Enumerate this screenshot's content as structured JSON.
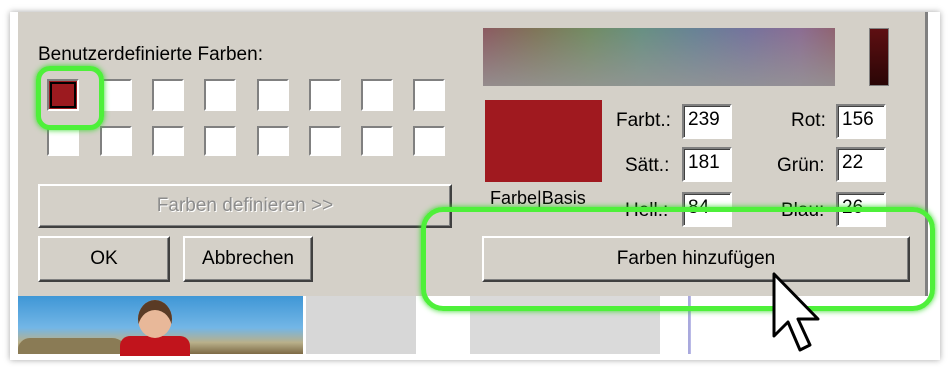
{
  "dialog": {
    "custom_colors_label": "Benutzerdefinierte Farben:",
    "define_colors_button": "Farben definieren >>",
    "ok_button": "OK",
    "cancel_button": "Abbrechen",
    "custom_colors": [
      "#9c1a1f",
      "#ffffff",
      "#ffffff",
      "#ffffff",
      "#ffffff",
      "#ffffff",
      "#ffffff",
      "#ffffff",
      "#ffffff",
      "#ffffff",
      "#ffffff",
      "#ffffff",
      "#ffffff",
      "#ffffff",
      "#ffffff",
      "#ffffff"
    ],
    "color_solid_label": "Farbe|Basis",
    "add_colors_button": "Farben hinzufügen",
    "fields": {
      "hue_label": "Farbt.:",
      "hue_value": "239",
      "sat_label": "Sätt.:",
      "sat_value": "181",
      "lum_label": "Hell.:",
      "lum_value": "84",
      "red_label": "Rot:",
      "red_value": "156",
      "green_label": "Grün:",
      "green_value": "22",
      "blue_label": "Blau:",
      "blue_value": "26"
    }
  },
  "colors": {
    "dialog_bg": "#d4d0c8",
    "selected_color": "#9c1a1f",
    "preview_color": "#a0191f",
    "highlight": "#4ef03a"
  },
  "icons": {
    "cursor": "arrow-pointer-icon"
  }
}
